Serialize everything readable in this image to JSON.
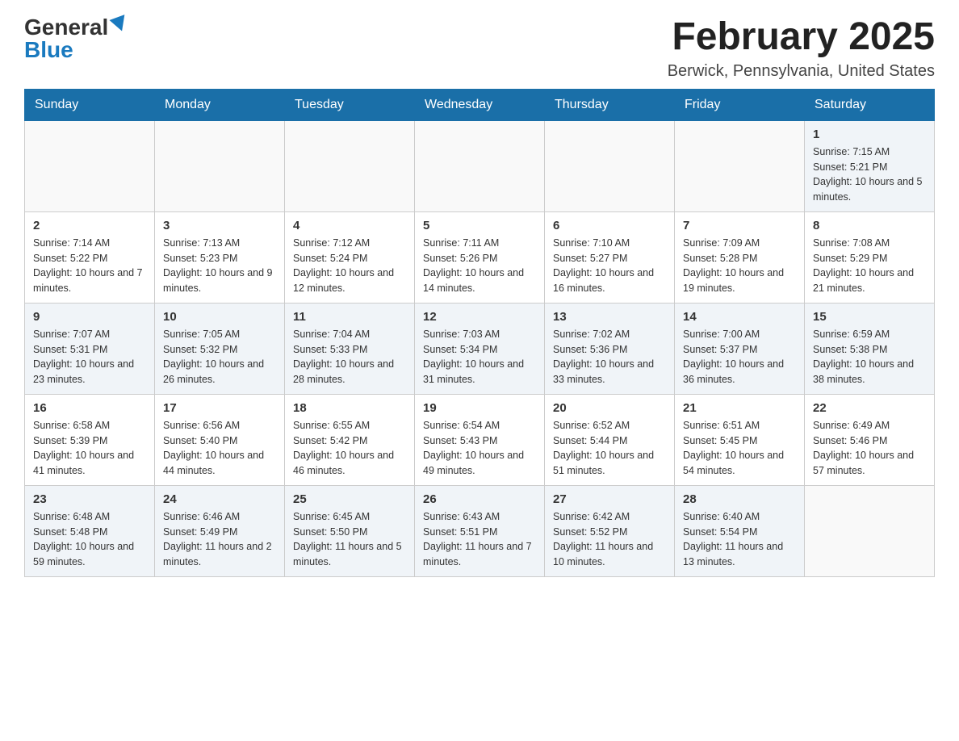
{
  "logo": {
    "general": "General",
    "blue": "Blue"
  },
  "title": {
    "month": "February 2025",
    "location": "Berwick, Pennsylvania, United States"
  },
  "days_of_week": [
    "Sunday",
    "Monday",
    "Tuesday",
    "Wednesday",
    "Thursday",
    "Friday",
    "Saturday"
  ],
  "weeks": [
    [
      {
        "day": "",
        "info": ""
      },
      {
        "day": "",
        "info": ""
      },
      {
        "day": "",
        "info": ""
      },
      {
        "day": "",
        "info": ""
      },
      {
        "day": "",
        "info": ""
      },
      {
        "day": "",
        "info": ""
      },
      {
        "day": "1",
        "info": "Sunrise: 7:15 AM\nSunset: 5:21 PM\nDaylight: 10 hours and 5 minutes."
      }
    ],
    [
      {
        "day": "2",
        "info": "Sunrise: 7:14 AM\nSunset: 5:22 PM\nDaylight: 10 hours and 7 minutes."
      },
      {
        "day": "3",
        "info": "Sunrise: 7:13 AM\nSunset: 5:23 PM\nDaylight: 10 hours and 9 minutes."
      },
      {
        "day": "4",
        "info": "Sunrise: 7:12 AM\nSunset: 5:24 PM\nDaylight: 10 hours and 12 minutes."
      },
      {
        "day": "5",
        "info": "Sunrise: 7:11 AM\nSunset: 5:26 PM\nDaylight: 10 hours and 14 minutes."
      },
      {
        "day": "6",
        "info": "Sunrise: 7:10 AM\nSunset: 5:27 PM\nDaylight: 10 hours and 16 minutes."
      },
      {
        "day": "7",
        "info": "Sunrise: 7:09 AM\nSunset: 5:28 PM\nDaylight: 10 hours and 19 minutes."
      },
      {
        "day": "8",
        "info": "Sunrise: 7:08 AM\nSunset: 5:29 PM\nDaylight: 10 hours and 21 minutes."
      }
    ],
    [
      {
        "day": "9",
        "info": "Sunrise: 7:07 AM\nSunset: 5:31 PM\nDaylight: 10 hours and 23 minutes."
      },
      {
        "day": "10",
        "info": "Sunrise: 7:05 AM\nSunset: 5:32 PM\nDaylight: 10 hours and 26 minutes."
      },
      {
        "day": "11",
        "info": "Sunrise: 7:04 AM\nSunset: 5:33 PM\nDaylight: 10 hours and 28 minutes."
      },
      {
        "day": "12",
        "info": "Sunrise: 7:03 AM\nSunset: 5:34 PM\nDaylight: 10 hours and 31 minutes."
      },
      {
        "day": "13",
        "info": "Sunrise: 7:02 AM\nSunset: 5:36 PM\nDaylight: 10 hours and 33 minutes."
      },
      {
        "day": "14",
        "info": "Sunrise: 7:00 AM\nSunset: 5:37 PM\nDaylight: 10 hours and 36 minutes."
      },
      {
        "day": "15",
        "info": "Sunrise: 6:59 AM\nSunset: 5:38 PM\nDaylight: 10 hours and 38 minutes."
      }
    ],
    [
      {
        "day": "16",
        "info": "Sunrise: 6:58 AM\nSunset: 5:39 PM\nDaylight: 10 hours and 41 minutes."
      },
      {
        "day": "17",
        "info": "Sunrise: 6:56 AM\nSunset: 5:40 PM\nDaylight: 10 hours and 44 minutes."
      },
      {
        "day": "18",
        "info": "Sunrise: 6:55 AM\nSunset: 5:42 PM\nDaylight: 10 hours and 46 minutes."
      },
      {
        "day": "19",
        "info": "Sunrise: 6:54 AM\nSunset: 5:43 PM\nDaylight: 10 hours and 49 minutes."
      },
      {
        "day": "20",
        "info": "Sunrise: 6:52 AM\nSunset: 5:44 PM\nDaylight: 10 hours and 51 minutes."
      },
      {
        "day": "21",
        "info": "Sunrise: 6:51 AM\nSunset: 5:45 PM\nDaylight: 10 hours and 54 minutes."
      },
      {
        "day": "22",
        "info": "Sunrise: 6:49 AM\nSunset: 5:46 PM\nDaylight: 10 hours and 57 minutes."
      }
    ],
    [
      {
        "day": "23",
        "info": "Sunrise: 6:48 AM\nSunset: 5:48 PM\nDaylight: 10 hours and 59 minutes."
      },
      {
        "day": "24",
        "info": "Sunrise: 6:46 AM\nSunset: 5:49 PM\nDaylight: 11 hours and 2 minutes."
      },
      {
        "day": "25",
        "info": "Sunrise: 6:45 AM\nSunset: 5:50 PM\nDaylight: 11 hours and 5 minutes."
      },
      {
        "day": "26",
        "info": "Sunrise: 6:43 AM\nSunset: 5:51 PM\nDaylight: 11 hours and 7 minutes."
      },
      {
        "day": "27",
        "info": "Sunrise: 6:42 AM\nSunset: 5:52 PM\nDaylight: 11 hours and 10 minutes."
      },
      {
        "day": "28",
        "info": "Sunrise: 6:40 AM\nSunset: 5:54 PM\nDaylight: 11 hours and 13 minutes."
      },
      {
        "day": "",
        "info": ""
      }
    ]
  ]
}
